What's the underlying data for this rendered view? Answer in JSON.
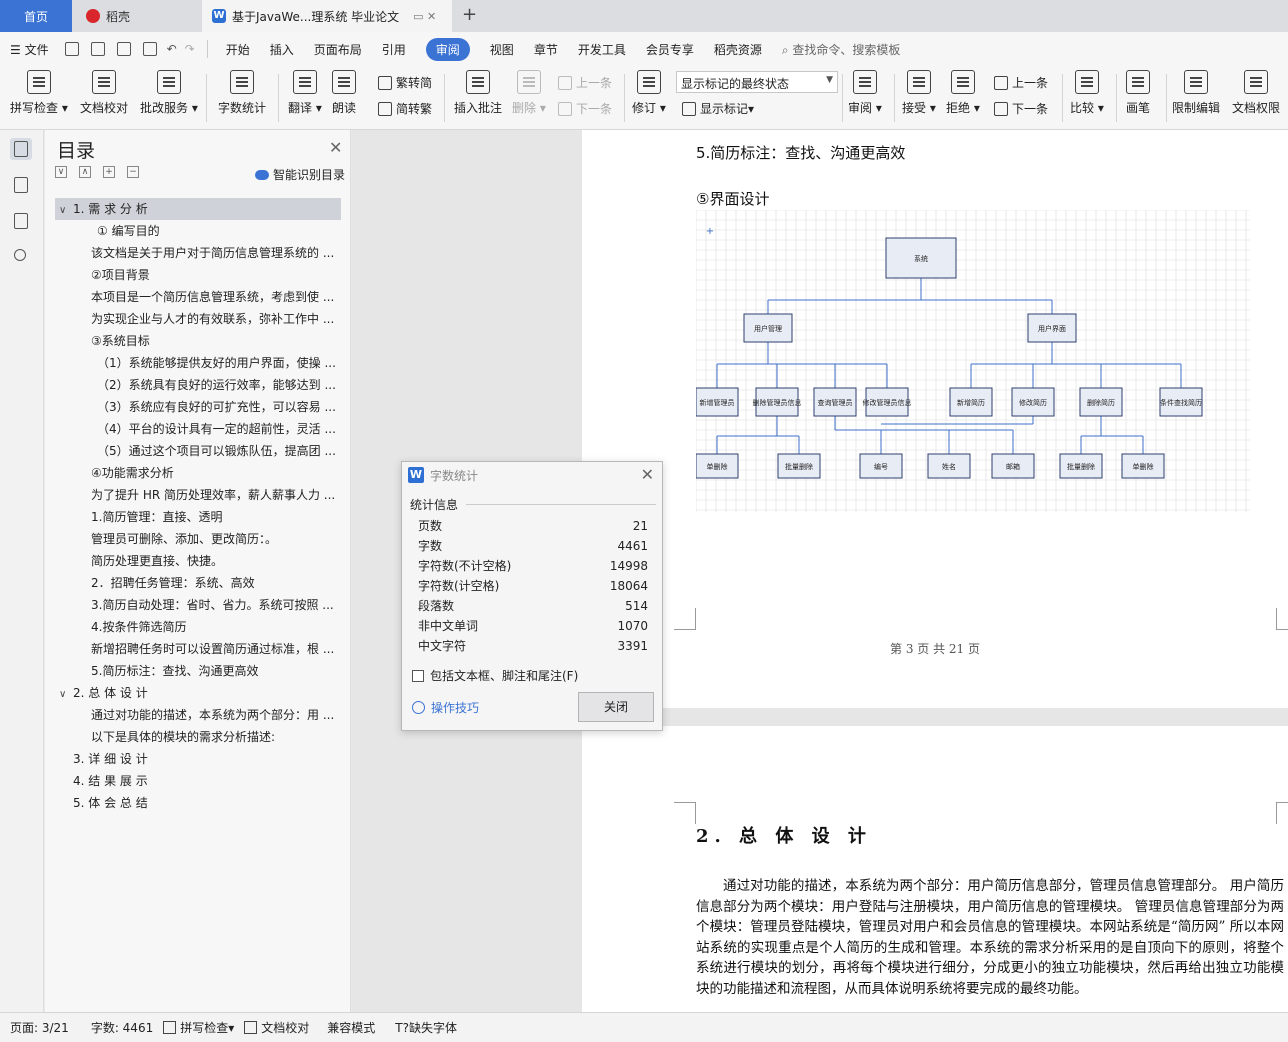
{
  "tabs": {
    "home": "首页",
    "daoke": "稻壳",
    "doc": "基于JavaWe...理系统 毕业论文",
    "add": "+"
  },
  "menu": {
    "file": "文件",
    "items": [
      "开始",
      "插入",
      "页面布局",
      "引用",
      "审阅",
      "视图",
      "章节",
      "开发工具",
      "会员专享",
      "稻壳资源"
    ],
    "active": "审阅",
    "search": "查找命令、搜索模板"
  },
  "ribbon": {
    "spell": "拼写检查",
    "proof": "文档校对",
    "batch": "批改服务",
    "wordcount": "字数统计",
    "translate": "翻译",
    "read": "朗读",
    "trad": "繁转简",
    "simp": "简转繁",
    "insert_comment": "插入批注",
    "delete": "删除",
    "prev": "上一条",
    "next": "下一条",
    "revise": "修订",
    "markup_state": "显示标记的最终状态",
    "show_markup": "显示标记",
    "review": "审阅",
    "accept": "接受",
    "reject": "拒绝",
    "prev2": "上一条",
    "next2": "下一条",
    "compare": "比较",
    "pen": "画笔",
    "restrict": "限制编辑",
    "rights": "文档权限"
  },
  "toc": {
    "title": "目录",
    "smart": "智能识别目录",
    "items": [
      {
        "text": "1. 需 求 分 析",
        "level": 1,
        "toggle": "∨",
        "selected": true
      },
      {
        "text": "① 编写目的",
        "level": 3
      },
      {
        "text": "该文档是关于用户对于简历信息管理系统的 ...",
        "level": 2
      },
      {
        "text": "②项目背景",
        "level": 2
      },
      {
        "text": "本项目是一个简历信息管理系统，考虑到使 ...",
        "level": 2
      },
      {
        "text": "为实现企业与人才的有效联系，弥补工作中 ...",
        "level": 2
      },
      {
        "text": "③系统目标",
        "level": 2
      },
      {
        "text": "（1）系统能够提供友好的用户界面，使操 ...",
        "level": 3
      },
      {
        "text": "（2）系统具有良好的运行效率，能够达到 ...",
        "level": 3
      },
      {
        "text": "（3）系统应有良好的可扩充性，可以容易 ...",
        "level": 3
      },
      {
        "text": "（4）平台的设计具有一定的超前性，灵活 ...",
        "level": 3
      },
      {
        "text": "（5）通过这个项目可以锻炼队伍，提高团 ...",
        "level": 3
      },
      {
        "text": "④功能需求分析",
        "level": 2
      },
      {
        "text": "为了提升 HR 简历处理效率，薪人薪事人力 ...",
        "level": 2
      },
      {
        "text": "1.简历管理：直接、透明",
        "level": 2
      },
      {
        "text": "管理员可删除、添加、更改简历：。",
        "level": 2
      },
      {
        "text": "简历处理更直接、快捷。",
        "level": 2
      },
      {
        "text": "2．招聘任务管理：系统、高效",
        "level": 2
      },
      {
        "text": "3.简历自动处理：省时、省力。系统可按照 ...",
        "level": 2
      },
      {
        "text": "4.按条件筛选简历",
        "level": 2
      },
      {
        "text": "新增招聘任务时可以设置简历通过标准，根 ...",
        "level": 2
      },
      {
        "text": "5.简历标注：查找、沟通更高效",
        "level": 2
      },
      {
        "text": "2. 总 体 设 计",
        "level": 1,
        "toggle": "∨"
      },
      {
        "text": "通过对功能的描述，本系统为两个部分：用 ...",
        "level": 2
      },
      {
        "text": "以下是具体的模块的需求分析描述:",
        "level": 2
      },
      {
        "text": "3. 详 细 设 计",
        "level": 4
      },
      {
        "text": "4. 结 果 展 示",
        "level": 4
      },
      {
        "text": "5. 体 会 总 结",
        "level": 4
      }
    ]
  },
  "page1": {
    "line1": "5.简历标注：查找、沟通更高效",
    "line2": "⑤界面设计",
    "footer": "第 3 页 共 21 页"
  },
  "diagram": {
    "root": "系统",
    "mid": [
      "用户管理",
      "用户界面"
    ],
    "level3": [
      "新增管理员",
      "删除管理员信息",
      "查询管理员",
      "修改管理员信息",
      "新增简历",
      "修改简历",
      "删除简历",
      "条件查找简历"
    ],
    "level4": [
      "单删除",
      "批量删除",
      "编号",
      "姓名",
      "邮箱",
      "批量删除",
      "单删除"
    ]
  },
  "page2": {
    "heading": "2. 总 体 设 计",
    "body": "通过对功能的描述，本系统为两个部分：用户简历信息部分，管理员信息管理部分。 用户简历信息部分为两个模块：用户登陆与注册模块，用户简历信息的管理模块。 管理员信息管理部分为两个模块：管理员登陆模块，管理员对用户和会员信息的管理模块。本网站系统是“简历网” 所以本网站系统的实现重点是个人简历的生成和管理。本系统的需求分析采用的是自顶向下的原则，将整个系统进行模块的划分，再将每个模块进行细分，分成更小的独立功能模块，然后再给出独立功能模块的功能描述和流程图，从而具体说明系统将要完成的最终功能。"
  },
  "dialog": {
    "title": "字数统计",
    "section": "统计信息",
    "stats": [
      {
        "label": "页数",
        "value": "21"
      },
      {
        "label": "字数",
        "value": "4461"
      },
      {
        "label": "字符数(不计空格)",
        "value": "14998"
      },
      {
        "label": "字符数(计空格)",
        "value": "18064"
      },
      {
        "label": "段落数",
        "value": "514"
      },
      {
        "label": "非中文单词",
        "value": "1070"
      },
      {
        "label": "中文字符",
        "value": "3391"
      }
    ],
    "checkbox": "包括文本框、脚注和尾注(F)",
    "tips": "操作技巧",
    "close": "关闭"
  },
  "status": {
    "page": "页面: 3/21",
    "words": "字数: 4461",
    "spell": "拼写检查",
    "proof": "文档校对",
    "compat": "兼容模式",
    "font": "缺失字体"
  }
}
